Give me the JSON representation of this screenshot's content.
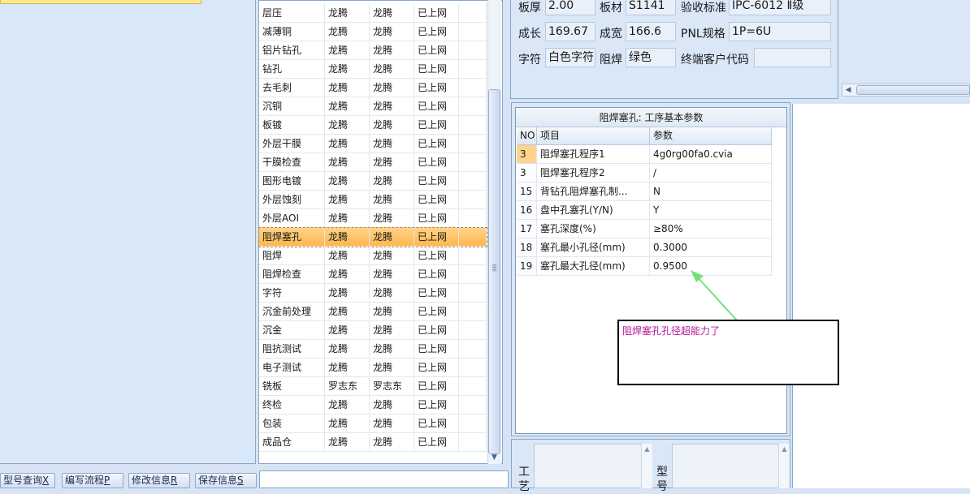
{
  "toolbar": {
    "model_query": "型号查询",
    "model_query_key": "X",
    "edit_flow": "编写流程",
    "edit_flow_key": "P",
    "modify_info": "修改信息",
    "modify_info_key": "R",
    "save_info": "保存信息",
    "save_info_key": "S"
  },
  "process_rows": [
    {
      "name": "层压",
      "a": "龙腾",
      "b": "龙腾",
      "status": "已上网"
    },
    {
      "name": "减薄铜",
      "a": "龙腾",
      "b": "龙腾",
      "status": "已上网"
    },
    {
      "name": "铝片钻孔",
      "a": "龙腾",
      "b": "龙腾",
      "status": "已上网"
    },
    {
      "name": "钻孔",
      "a": "龙腾",
      "b": "龙腾",
      "status": "已上网"
    },
    {
      "name": "去毛刺",
      "a": "龙腾",
      "b": "龙腾",
      "status": "已上网"
    },
    {
      "name": "沉铜",
      "a": "龙腾",
      "b": "龙腾",
      "status": "已上网"
    },
    {
      "name": "板镀",
      "a": "龙腾",
      "b": "龙腾",
      "status": "已上网"
    },
    {
      "name": "外层干膜",
      "a": "龙腾",
      "b": "龙腾",
      "status": "已上网"
    },
    {
      "name": "干膜检查",
      "a": "龙腾",
      "b": "龙腾",
      "status": "已上网"
    },
    {
      "name": "图形电镀",
      "a": "龙腾",
      "b": "龙腾",
      "status": "已上网"
    },
    {
      "name": "外层蚀刻",
      "a": "龙腾",
      "b": "龙腾",
      "status": "已上网"
    },
    {
      "name": "外层AOI",
      "a": "龙腾",
      "b": "龙腾",
      "status": "已上网"
    },
    {
      "name": "阻焊塞孔",
      "a": "龙腾",
      "b": "龙腾",
      "status": "已上网"
    },
    {
      "name": "阻焊",
      "a": "龙腾",
      "b": "龙腾",
      "status": "已上网"
    },
    {
      "name": "阻焊检查",
      "a": "龙腾",
      "b": "龙腾",
      "status": "已上网"
    },
    {
      "name": "字符",
      "a": "龙腾",
      "b": "龙腾",
      "status": "已上网"
    },
    {
      "name": "沉金前处理",
      "a": "龙腾",
      "b": "龙腾",
      "status": "已上网"
    },
    {
      "name": "沉金",
      "a": "龙腾",
      "b": "龙腾",
      "status": "已上网"
    },
    {
      "name": "阻抗测试",
      "a": "龙腾",
      "b": "龙腾",
      "status": "已上网"
    },
    {
      "name": "电子测试",
      "a": "龙腾",
      "b": "龙腾",
      "status": "已上网"
    },
    {
      "name": "铣板",
      "a": "罗志东",
      "b": "罗志东",
      "status": "已上网"
    },
    {
      "name": "终检",
      "a": "龙腾",
      "b": "龙腾",
      "status": "已上网"
    },
    {
      "name": "包装",
      "a": "龙腾",
      "b": "龙腾",
      "status": "已上网"
    },
    {
      "name": "成品仓",
      "a": "龙腾",
      "b": "龙腾",
      "status": "已上网"
    }
  ],
  "selected_row_index": 12,
  "info": {
    "thickness_label": "板厚",
    "thickness_value": "2.00",
    "material_label": "板材",
    "material_value": "S1141",
    "standard_label": "验收标准",
    "standard_value": "IPC-6012 Ⅱ级",
    "length_label": "成长",
    "length_value": "169.67",
    "width_label": "成宽",
    "width_value": "166.6",
    "pnl_label": "PNL规格",
    "pnl_value": "1P=6U",
    "char_label": "字符",
    "char_value": "白色字符",
    "mask_label": "阻焊",
    "mask_value": "绿色",
    "customer_code_label": "终端客户代码",
    "customer_code_value": ""
  },
  "param_panel": {
    "title": "阻焊塞孔: 工序基本参数",
    "col_no": "NO",
    "col_item": "项目",
    "col_param": "参数",
    "rows": [
      {
        "no": "3",
        "item": "阻焊塞孔程序1",
        "value": "4g0rg00fa0.cvia",
        "highlight": true
      },
      {
        "no": "3",
        "item": "阻焊塞孔程序2",
        "value": "/",
        "highlight": false
      },
      {
        "no": "15",
        "item": "背钻孔阻焊塞孔制...",
        "value": "N",
        "highlight": false
      },
      {
        "no": "16",
        "item": "盘中孔塞孔(Y/N)",
        "value": "Y",
        "highlight": false
      },
      {
        "no": "17",
        "item": "塞孔深度(%)",
        "value": "≥80%",
        "highlight": false
      },
      {
        "no": "18",
        "item": "塞孔最小孔径(mm)",
        "value": "0.3000",
        "highlight": false
      },
      {
        "no": "19",
        "item": "塞孔最大孔径(mm)",
        "value": "0.9500",
        "highlight": false
      }
    ]
  },
  "annotation": {
    "text": "阻焊塞孔孔径超能力了",
    "color": "#b2189b",
    "arrow_color": "#6fe27a"
  },
  "bottom": {
    "process_label_1": "工",
    "process_label_2": "艺",
    "model_label_1": "型",
    "model_label_2": "号"
  }
}
